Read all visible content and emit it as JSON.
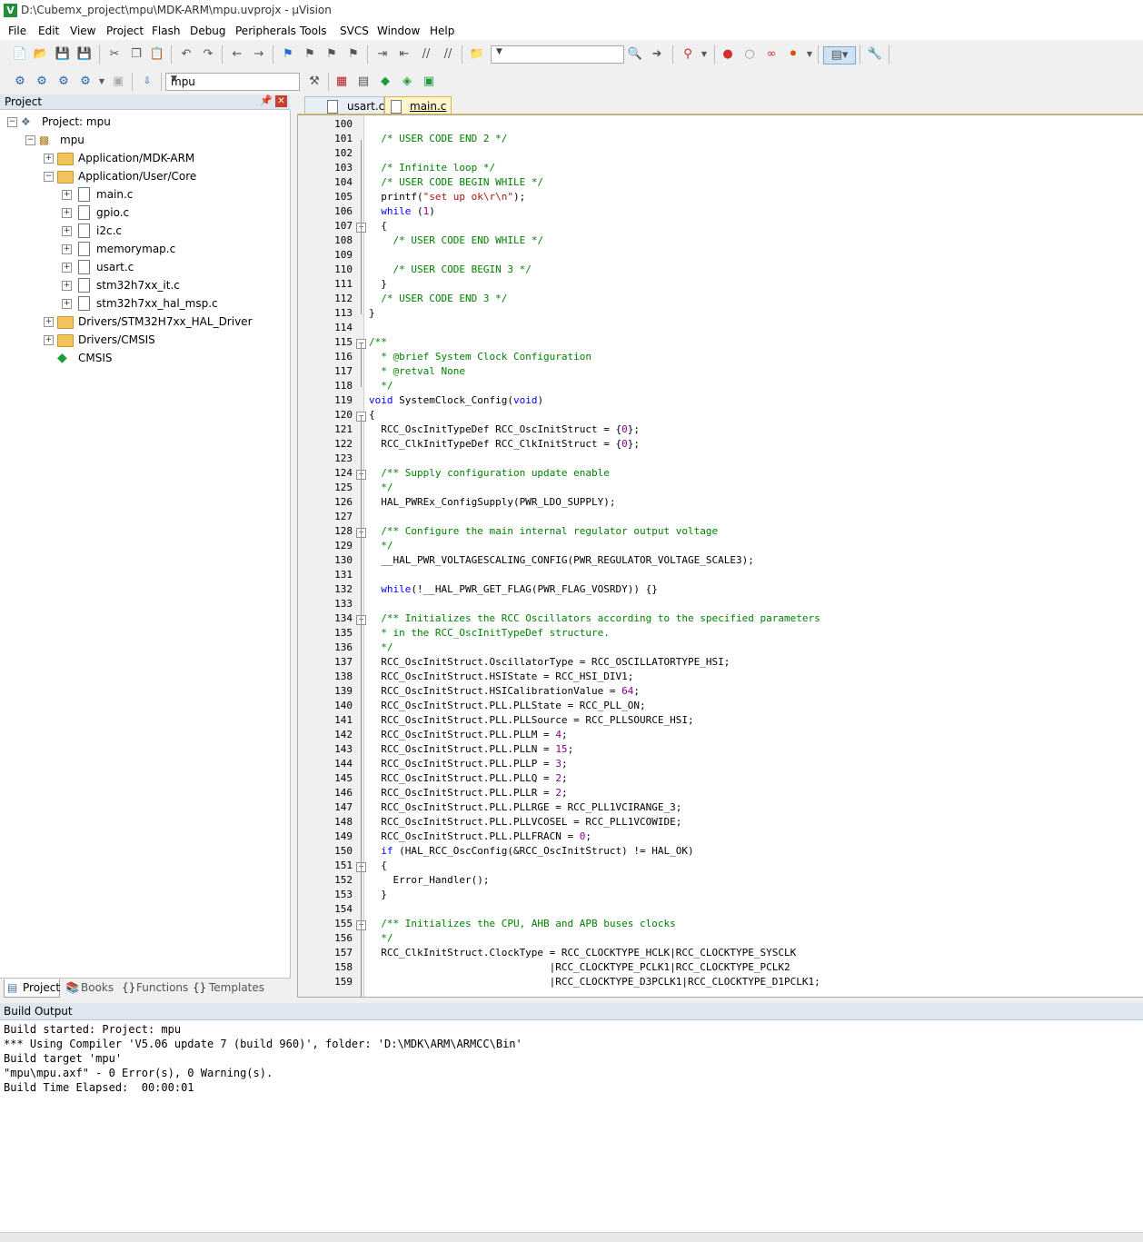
{
  "window": {
    "title": "D:\\Cubemx_project\\mpu\\MDK-ARM\\mpu.uvprojx - µVision"
  },
  "menu": [
    "File",
    "Edit",
    "View",
    "Project",
    "Flash",
    "Debug",
    "Peripherals",
    "Tools",
    "SVCS",
    "Window",
    "Help"
  ],
  "toolbar2": {
    "target": "mpu"
  },
  "project_panel": {
    "title": "Project",
    "tree": {
      "root": "Project: mpu",
      "target": "mpu",
      "groups": [
        "Application/MDK-ARM",
        "Application/User/Core",
        "Drivers/STM32H7xx_HAL_Driver",
        "Drivers/CMSIS",
        "CMSIS"
      ],
      "files": [
        "main.c",
        "gpio.c",
        "i2c.c",
        "memorymap.c",
        "usart.c",
        "stm32h7xx_it.c",
        "stm32h7xx_hal_msp.c"
      ]
    },
    "tabs": [
      "Project",
      "Books",
      "Functions",
      "Templates"
    ]
  },
  "editor": {
    "tabs": [
      "usart.c",
      "main.c"
    ],
    "active_tab": "main.c",
    "lines": [
      {
        "n": "100",
        "t": ""
      },
      {
        "n": "101",
        "t": "  /* USER CODE END 2 */"
      },
      {
        "n": "102",
        "t": ""
      },
      {
        "n": "103",
        "t": "  /* Infinite loop */"
      },
      {
        "n": "104",
        "t": "  /* USER CODE BEGIN WHILE */"
      },
      {
        "n": "105",
        "t": "  printf(\"set up ok\\r\\n\");"
      },
      {
        "n": "106",
        "t": "  while (1)"
      },
      {
        "n": "107",
        "t": "  {"
      },
      {
        "n": "108",
        "t": "    /* USER CODE END WHILE */"
      },
      {
        "n": "109",
        "t": ""
      },
      {
        "n": "110",
        "t": "    /* USER CODE BEGIN 3 */"
      },
      {
        "n": "111",
        "t": "  }"
      },
      {
        "n": "112",
        "t": "  /* USER CODE END 3 */"
      },
      {
        "n": "113",
        "t": "}"
      },
      {
        "n": "114",
        "t": ""
      },
      {
        "n": "115",
        "t": "/**"
      },
      {
        "n": "116",
        "t": "  * @brief System Clock Configuration"
      },
      {
        "n": "117",
        "t": "  * @retval None"
      },
      {
        "n": "118",
        "t": "  */"
      },
      {
        "n": "119",
        "t": "void SystemClock_Config(void)"
      },
      {
        "n": "120",
        "t": "{"
      },
      {
        "n": "121",
        "t": "  RCC_OscInitTypeDef RCC_OscInitStruct = {0};"
      },
      {
        "n": "122",
        "t": "  RCC_ClkInitTypeDef RCC_ClkInitStruct = {0};"
      },
      {
        "n": "123",
        "t": ""
      },
      {
        "n": "124",
        "t": "  /** Supply configuration update enable"
      },
      {
        "n": "125",
        "t": "  */"
      },
      {
        "n": "126",
        "t": "  HAL_PWREx_ConfigSupply(PWR_LDO_SUPPLY);"
      },
      {
        "n": "127",
        "t": ""
      },
      {
        "n": "128",
        "t": "  /** Configure the main internal regulator output voltage"
      },
      {
        "n": "129",
        "t": "  */"
      },
      {
        "n": "130",
        "t": "  __HAL_PWR_VOLTAGESCALING_CONFIG(PWR_REGULATOR_VOLTAGE_SCALE3);"
      },
      {
        "n": "131",
        "t": ""
      },
      {
        "n": "132",
        "t": "  while(!__HAL_PWR_GET_FLAG(PWR_FLAG_VOSRDY)) {}"
      },
      {
        "n": "133",
        "t": ""
      },
      {
        "n": "134",
        "t": "  /** Initializes the RCC Oscillators according to the specified parameters"
      },
      {
        "n": "135",
        "t": "  * in the RCC_OscInitTypeDef structure."
      },
      {
        "n": "136",
        "t": "  */"
      },
      {
        "n": "137",
        "t": "  RCC_OscInitStruct.OscillatorType = RCC_OSCILLATORTYPE_HSI;"
      },
      {
        "n": "138",
        "t": "  RCC_OscInitStruct.HSIState = RCC_HSI_DIV1;"
      },
      {
        "n": "139",
        "t": "  RCC_OscInitStruct.HSICalibrationValue = 64;"
      },
      {
        "n": "140",
        "t": "  RCC_OscInitStruct.PLL.PLLState = RCC_PLL_ON;"
      },
      {
        "n": "141",
        "t": "  RCC_OscInitStruct.PLL.PLLSource = RCC_PLLSOURCE_HSI;"
      },
      {
        "n": "142",
        "t": "  RCC_OscInitStruct.PLL.PLLM = 4;"
      },
      {
        "n": "143",
        "t": "  RCC_OscInitStruct.PLL.PLLN = 15;"
      },
      {
        "n": "144",
        "t": "  RCC_OscInitStruct.PLL.PLLP = 3;"
      },
      {
        "n": "145",
        "t": "  RCC_OscInitStruct.PLL.PLLQ = 2;"
      },
      {
        "n": "146",
        "t": "  RCC_OscInitStruct.PLL.PLLR = 2;"
      },
      {
        "n": "147",
        "t": "  RCC_OscInitStruct.PLL.PLLRGE = RCC_PLL1VCIRANGE_3;"
      },
      {
        "n": "148",
        "t": "  RCC_OscInitStruct.PLL.PLLVCOSEL = RCC_PLL1VCOWIDE;"
      },
      {
        "n": "149",
        "t": "  RCC_OscInitStruct.PLL.PLLFRACN = 0;"
      },
      {
        "n": "150",
        "t": "  if (HAL_RCC_OscConfig(&RCC_OscInitStruct) != HAL_OK)"
      },
      {
        "n": "151",
        "t": "  {"
      },
      {
        "n": "152",
        "t": "    Error_Handler();"
      },
      {
        "n": "153",
        "t": "  }"
      },
      {
        "n": "154",
        "t": ""
      },
      {
        "n": "155",
        "t": "  /** Initializes the CPU, AHB and APB buses clocks"
      },
      {
        "n": "156",
        "t": "  */"
      },
      {
        "n": "157",
        "t": "  RCC_ClkInitStruct.ClockType = RCC_CLOCKTYPE_HCLK|RCC_CLOCKTYPE_SYSCLK"
      },
      {
        "n": "158",
        "t": "                              |RCC_CLOCKTYPE_PCLK1|RCC_CLOCKTYPE_PCLK2"
      },
      {
        "n": "159",
        "t": "                              |RCC_CLOCKTYPE_D3PCLK1|RCC_CLOCKTYPE_D1PCLK1;"
      }
    ]
  },
  "build_output": {
    "title": "Build Output",
    "lines": [
      "Build started: Project: mpu",
      "*** Using Compiler 'V5.06 update 7 (build 960)', folder: 'D:\\MDK\\ARM\\ARMCC\\Bin'",
      "Build target 'mpu'",
      "\"mpu\\mpu.axf\" - 0 Error(s), 0 Warning(s).",
      "Build Time Elapsed:  00:00:01"
    ]
  }
}
